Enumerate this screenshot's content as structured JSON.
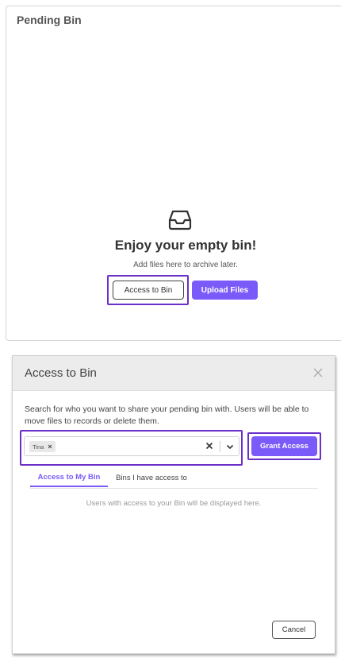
{
  "pending_bin": {
    "title": "Pending Bin",
    "empty_heading": "Enjoy your empty bin!",
    "empty_subtext": "Add files here to archive later.",
    "access_button": "Access to Bin",
    "upload_button": "Upload Files"
  },
  "modal": {
    "title": "Access to Bin",
    "description": "Search for who you want to share your pending bin with. Users will be able to move files to records or delete them.",
    "selected_users": [
      "Tina"
    ],
    "grant_button": "Grant Access",
    "tabs": [
      {
        "label": "Access to My Bin",
        "active": true
      },
      {
        "label": "Bins I have access to",
        "active": false
      }
    ],
    "empty_note": "Users with access to your Bin will be displayed here.",
    "cancel_button": "Cancel"
  },
  "colors": {
    "accent": "#7a5af8",
    "highlight": "#6b2fc9"
  },
  "icons": {
    "empty_bin": "inbox-icon",
    "modal_close": "close-icon",
    "chip_remove": "close-icon",
    "clear": "clear-icon",
    "dropdown": "chevron-down-icon"
  }
}
